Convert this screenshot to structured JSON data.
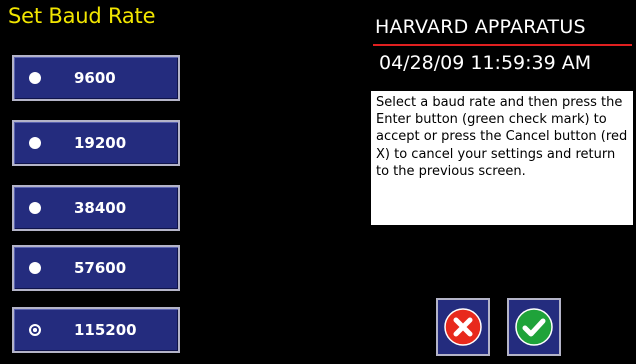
{
  "screen": {
    "title": "Set Baud Rate"
  },
  "baud_rates": [
    {
      "label": "9600",
      "selected": false
    },
    {
      "label": "19200",
      "selected": false
    },
    {
      "label": "38400",
      "selected": false
    },
    {
      "label": "57600",
      "selected": false
    },
    {
      "label": "115200",
      "selected": true
    }
  ],
  "header": {
    "brand": "HARVARD APPARATUS",
    "datetime": "04/28/09 11:59:39 AM"
  },
  "info": {
    "text": "Select a baud rate and then press the Enter button (green check mark) to accept or press the Cancel button (red X) to cancel your settings and return to the previous screen."
  },
  "actions": {
    "cancel_icon": "red-x-icon",
    "enter_icon": "green-check-icon"
  },
  "colors": {
    "title": "#f2e600",
    "button_bg": "#242c7e",
    "brand_rule": "#e02020",
    "cancel": "#e8291c",
    "enter": "#1fa33a"
  }
}
